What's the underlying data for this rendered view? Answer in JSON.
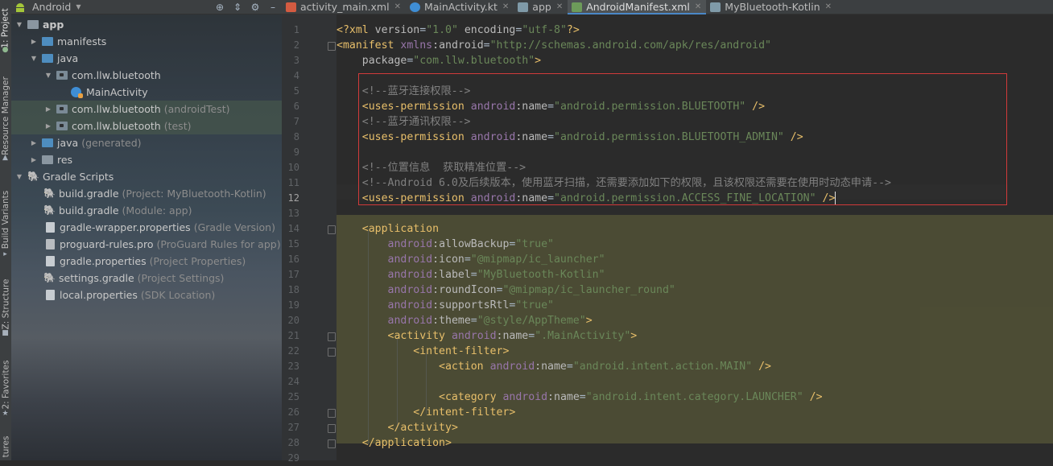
{
  "toolstrip": {
    "tabs": [
      "1: Project",
      "Resource Manager",
      "Build Variants",
      "Z: Structure",
      "2: Favorites",
      "tures"
    ]
  },
  "project_panel": {
    "view_selector": "Android",
    "toolbar_icons": [
      "target-icon",
      "collapse-icon",
      "gear-icon",
      "minimize-icon"
    ],
    "tree": [
      {
        "label": "app",
        "secondary": "",
        "icon": "module-folder-icon",
        "expanded": true
      },
      {
        "label": "manifests",
        "secondary": "",
        "icon": "folder-icon",
        "expanded": false
      },
      {
        "label": "java",
        "secondary": "",
        "icon": "folder-icon",
        "expanded": true
      },
      {
        "label": "com.llw.bluetooth",
        "secondary": "",
        "icon": "package-icon",
        "expanded": true
      },
      {
        "label": "MainActivity",
        "secondary": "",
        "icon": "kotlin-class-icon"
      },
      {
        "label": "com.llw.bluetooth",
        "secondary": "(androidTest)",
        "icon": "package-icon",
        "expanded": false
      },
      {
        "label": "com.llw.bluetooth",
        "secondary": "(test)",
        "icon": "package-icon",
        "expanded": false
      },
      {
        "label": "java",
        "secondary": "(generated)",
        "icon": "folder-icon",
        "expanded": false
      },
      {
        "label": "res",
        "secondary": "",
        "icon": "res-folder-icon",
        "expanded": false
      },
      {
        "label": "Gradle Scripts",
        "secondary": "",
        "icon": "gradle-icon",
        "expanded": true
      },
      {
        "label": "build.gradle",
        "secondary": "(Project: MyBluetooth-Kotlin)",
        "icon": "gradle-file-icon"
      },
      {
        "label": "build.gradle",
        "secondary": "(Module: app)",
        "icon": "gradle-file-icon"
      },
      {
        "label": "gradle-wrapper.properties",
        "secondary": "(Gradle Version)",
        "icon": "properties-file-icon"
      },
      {
        "label": "proguard-rules.pro",
        "secondary": "(ProGuard Rules for app)",
        "icon": "text-file-icon"
      },
      {
        "label": "gradle.properties",
        "secondary": "(Project Properties)",
        "icon": "properties-file-icon"
      },
      {
        "label": "settings.gradle",
        "secondary": "(Project Settings)",
        "icon": "gradle-file-icon"
      },
      {
        "label": "local.properties",
        "secondary": "(SDK Location)",
        "icon": "properties-file-icon"
      }
    ]
  },
  "editor": {
    "tabs": [
      {
        "label": "activity_main.xml",
        "icon": "xml-layout-icon",
        "active": false
      },
      {
        "label": "MainActivity.kt",
        "icon": "kotlin-class-icon",
        "active": false
      },
      {
        "label": "app",
        "icon": "gradle-icon",
        "active": false
      },
      {
        "label": "AndroidManifest.xml",
        "icon": "manifest-icon",
        "active": true
      },
      {
        "label": "MyBluetooth-Kotlin",
        "icon": "gradle-icon",
        "active": false
      }
    ],
    "current_line": 12,
    "line_numbers": [
      "1",
      "2",
      "3",
      "4",
      "5",
      "6",
      "7",
      "8",
      "9",
      "10",
      "11",
      "12",
      "13",
      "14",
      "15",
      "16",
      "17",
      "18",
      "19",
      "20",
      "21",
      "22",
      "23",
      "24",
      "25",
      "26",
      "27",
      "28",
      "29"
    ],
    "code": [
      "<?xml version=\"1.0\" encoding=\"utf-8\"?>",
      "<manifest xmlns:android=\"http://schemas.android.com/apk/res/android\"",
      "    package=\"com.llw.bluetooth\">",
      "",
      "    <!--蓝牙连接权限-->",
      "    <uses-permission android:name=\"android.permission.BLUETOOTH\" />",
      "    <!--蓝牙通讯权限-->",
      "    <uses-permission android:name=\"android.permission.BLUETOOTH_ADMIN\" />",
      "",
      "    <!--位置信息  获取精准位置-->",
      "    <!--Android 6.0及后续版本，使用蓝牙扫描，还需要添加如下的权限，且该权限还需要在使用时动态申请-->",
      "    <uses-permission android:name=\"android.permission.ACCESS_FINE_LOCATION\" />",
      "",
      "    <application",
      "        android:allowBackup=\"true\"",
      "        android:icon=\"@mipmap/ic_launcher\"",
      "        android:label=\"MyBluetooth-Kotlin\"",
      "        android:roundIcon=\"@mipmap/ic_launcher_round\"",
      "        android:supportsRtl=\"true\"",
      "        android:theme=\"@style/AppTheme\">",
      "        <activity android:name=\".MainActivity\">",
      "            <intent-filter>",
      "                <action android:name=\"android.intent.action.MAIN\" />",
      "",
      "                <category android:name=\"android.intent.category.LAUNCHER\" />",
      "            </intent-filter>",
      "        </activity>",
      "    </application>",
      ""
    ]
  }
}
